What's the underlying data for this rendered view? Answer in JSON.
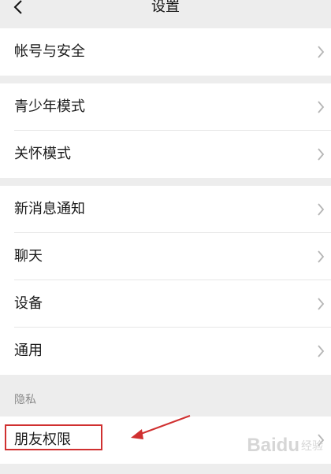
{
  "nav": {
    "title": "设置"
  },
  "groups": [
    {
      "items": [
        {
          "label": "帐号与安全"
        }
      ]
    },
    {
      "items": [
        {
          "label": "青少年模式"
        },
        {
          "label": "关怀模式"
        }
      ]
    },
    {
      "items": [
        {
          "label": "新消息通知"
        },
        {
          "label": "聊天"
        },
        {
          "label": "设备"
        },
        {
          "label": "通用"
        }
      ]
    }
  ],
  "privacy": {
    "section_title": "隐私",
    "items": [
      {
        "label": "朋友权限"
      }
    ]
  },
  "annotation": {
    "color": "#d03030"
  },
  "watermark": {
    "brand": "Baidu",
    "suffix": "经验"
  },
  "icons": {
    "back": "chevron-left-icon",
    "row_arrow": "chevron-right-icon"
  }
}
